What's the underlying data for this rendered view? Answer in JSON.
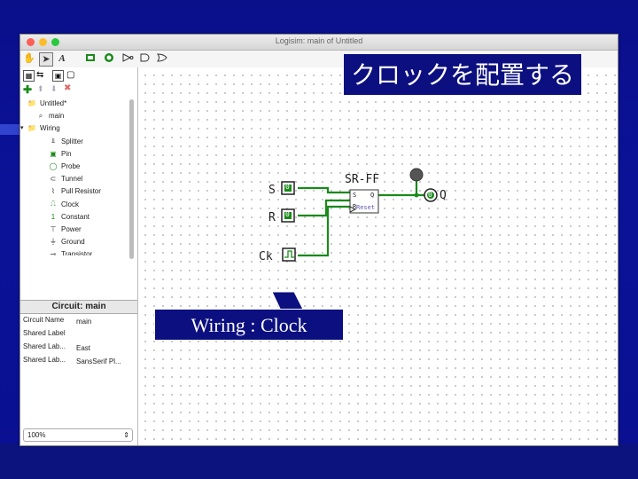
{
  "window": {
    "title": "Logisim: main of Untitled"
  },
  "toolbar": {
    "tools": [
      "hand-poke-icon",
      "arrow-select-icon",
      "text-tool-icon",
      "input-pin-icon",
      "output-pin-icon",
      "not-gate-icon",
      "and-gate-icon",
      "or-gate-icon"
    ]
  },
  "explorer": {
    "items": [
      {
        "label": "Untitled*",
        "icon": "folder-icon"
      },
      {
        "label": "main",
        "icon": "circuit-icon"
      },
      {
        "label": "Wiring",
        "icon": "folder-icon"
      },
      {
        "label": "Splitter",
        "icon": "splitter-icon"
      },
      {
        "label": "Pin",
        "icon": "pin-icon"
      },
      {
        "label": "Probe",
        "icon": "probe-icon"
      },
      {
        "label": "Tunnel",
        "icon": "tunnel-icon"
      },
      {
        "label": "Pull Resistor",
        "icon": "pull-resistor-icon"
      },
      {
        "label": "Clock",
        "icon": "clock-icon"
      },
      {
        "label": "Constant",
        "icon": "constant-icon"
      },
      {
        "label": "Power",
        "icon": "power-icon"
      },
      {
        "label": "Ground",
        "icon": "ground-icon"
      },
      {
        "label": "Transistor",
        "icon": "transistor-icon"
      }
    ]
  },
  "properties": {
    "header": "Circuit: main",
    "rows": [
      {
        "key": "Circuit Name",
        "value": "main"
      },
      {
        "key": "Shared Label",
        "value": ""
      },
      {
        "key": "Shared Lab...",
        "value": "East"
      },
      {
        "key": "Shared Lab...",
        "value": "SansSerif Pl..."
      }
    ]
  },
  "zoom": {
    "value": "100%"
  },
  "circuit": {
    "flipflop_label": "SR-FF",
    "ff_in1": "S",
    "ff_out1": "Q",
    "ff_in2": "R",
    "ff_in3": "Reset",
    "input_s": "S",
    "input_r": "R",
    "input_ck": "Ck",
    "output_q": "Q",
    "pin_value": "0"
  },
  "overlay": {
    "banner": "クロックを配置する",
    "callout": "Wiring : Clock"
  },
  "colors": {
    "wire": "#1a8a1a",
    "slide_bg": "#0a0f8a",
    "accent": "#ffffff"
  }
}
